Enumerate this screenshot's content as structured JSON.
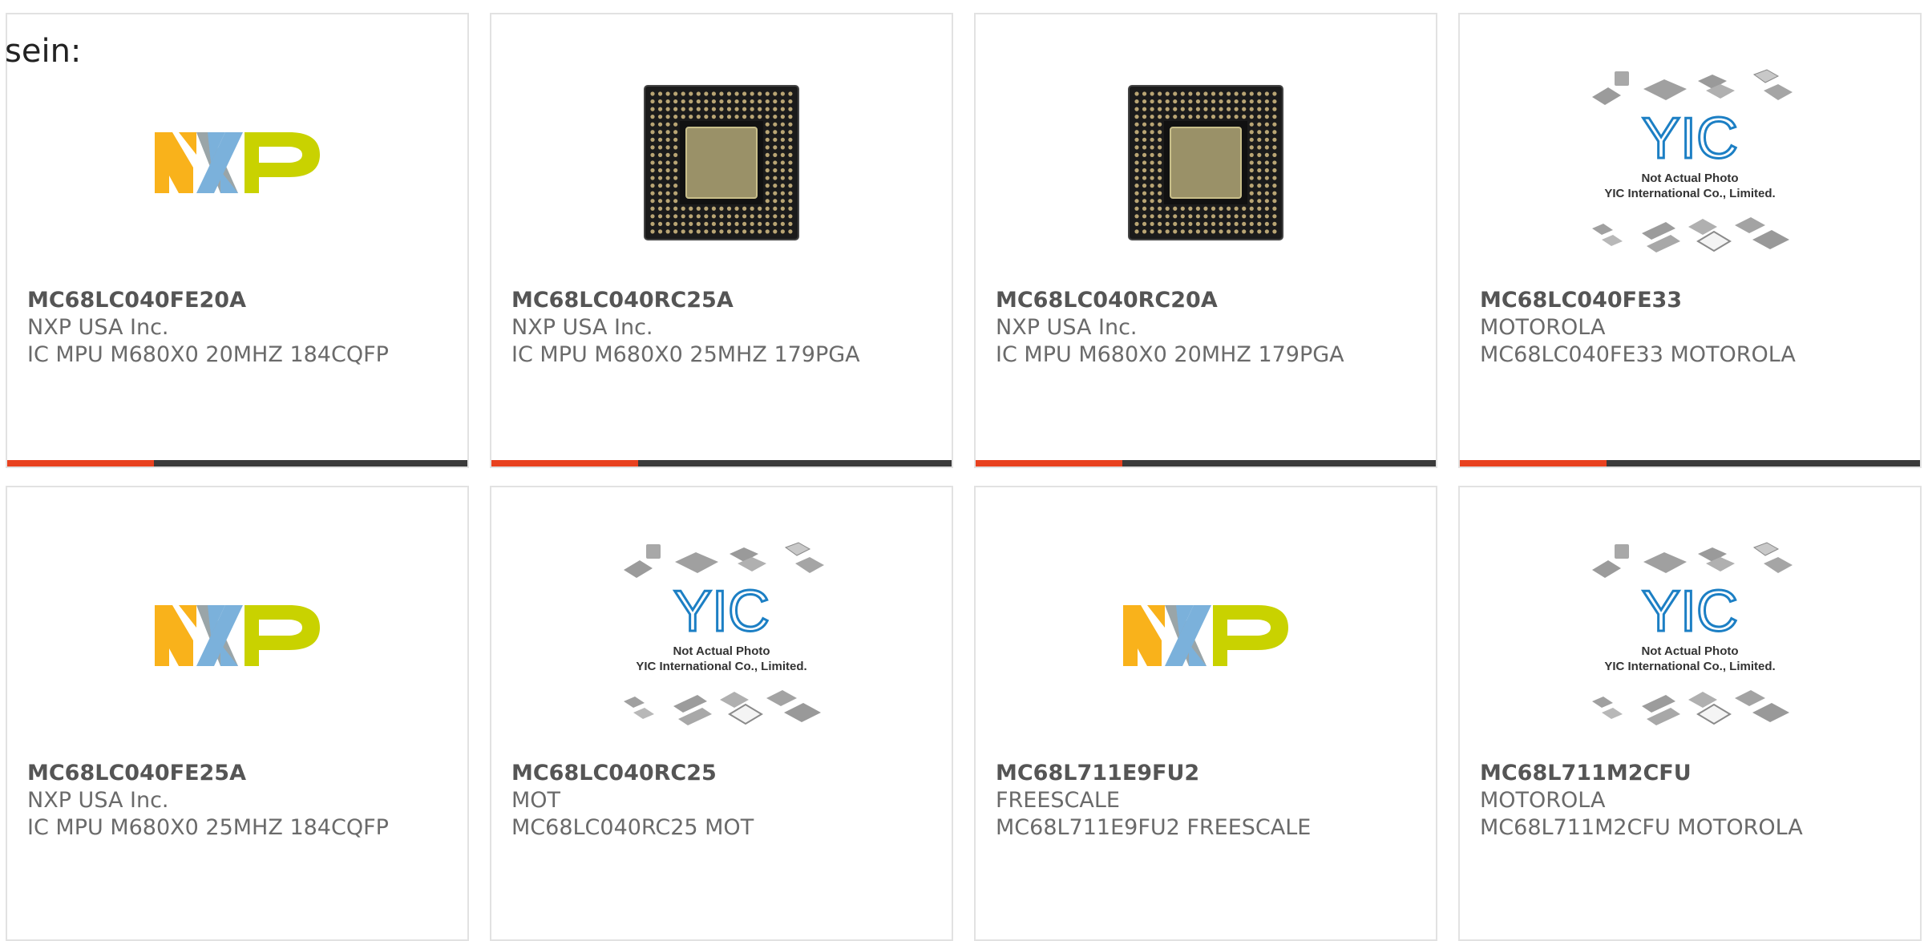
{
  "intro_text": "sein:",
  "image_caption": {
    "line1": "Not Actual Photo",
    "line2": "YIC International Co., Limited.",
    "logo_text": "YIC"
  },
  "products": [
    {
      "part": "MC68LC040FE20A",
      "maker": "NXP USA Inc.",
      "desc": "IC MPU M680X0 20MHZ 184CQFP",
      "image": "nxp-logo"
    },
    {
      "part": "MC68LC040RC25A",
      "maker": "NXP USA Inc.",
      "desc": "IC MPU M680X0 25MHZ 179PGA",
      "image": "pga-chip"
    },
    {
      "part": "MC68LC040RC20A",
      "maker": "NXP USA Inc.",
      "desc": "IC MPU M680X0 20MHZ 179PGA",
      "image": "pga-chip"
    },
    {
      "part": "MC68LC040FE33",
      "maker": "MOTOROLA",
      "desc": "MC68LC040FE33 MOTOROLA",
      "image": "yic-placeholder"
    },
    {
      "part": "MC68LC040FE25A",
      "maker": "NXP USA Inc.",
      "desc": "IC MPU M680X0 25MHZ 184CQFP",
      "image": "nxp-logo"
    },
    {
      "part": "MC68LC040RC25",
      "maker": "MOT",
      "desc": "MC68LC040RC25 MOT",
      "image": "yic-placeholder"
    },
    {
      "part": "MC68L711E9FU2",
      "maker": "FREESCALE",
      "desc": "MC68L711E9FU2 FREESCALE",
      "image": "nxp-logo"
    },
    {
      "part": "MC68L711M2CFU",
      "maker": "MOTOROLA",
      "desc": "MC68L711M2CFU MOTOROLA",
      "image": "yic-placeholder"
    }
  ],
  "colors": {
    "accent": "#e8411f",
    "bar": "#3a3a3a",
    "nxp_orange": "#f9b21b",
    "nxp_blue": "#7bb1db",
    "nxp_green": "#c9d200",
    "yic_blue": "#1c7fc4"
  }
}
